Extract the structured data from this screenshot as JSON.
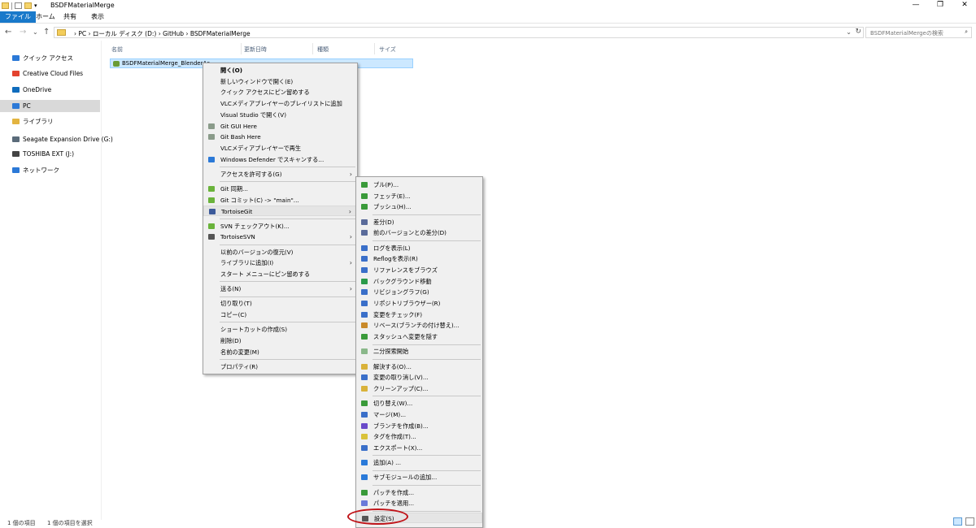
{
  "window": {
    "title": "BSDFMaterialMerge",
    "min": "—",
    "max": "❐",
    "close": "✕"
  },
  "ribbon": {
    "tabs": [
      "ファイル",
      "ホーム",
      "共有",
      "表示"
    ],
    "active_color": "#1979ca"
  },
  "nav": {
    "back": "←",
    "forward": "→",
    "down": "⌄",
    "up": "↑",
    "breadcrumb": "›  PC  ›  ローカル ディスク (D:)  ›  GitHub  ›  BSDFMaterialMerge",
    "refresh": "↻",
    "search_placeholder": "BSDFMaterialMergeの検索",
    "search_icon": "search-icon"
  },
  "sidebar": {
    "items": [
      {
        "label": "クイック アクセス",
        "icon": "star-icon",
        "color": "#2b79d7"
      },
      {
        "label": "Creative Cloud Files",
        "icon": "creative-cloud-icon",
        "color": "#e3432f"
      },
      {
        "label": "OneDrive",
        "icon": "cloud-icon",
        "color": "#0f6cbd"
      },
      {
        "label": "PC",
        "icon": "pc-icon",
        "color": "#2b79d7"
      },
      {
        "label": "ライブラリ",
        "icon": "library-icon",
        "color": "#e3b440"
      },
      {
        "label": "Seagate Expansion Drive (G:)",
        "icon": "drive-icon",
        "color": "#5a6b7a"
      },
      {
        "label": "TOSHIBA EXT (J:)",
        "icon": "drive-icon",
        "color": "#444444"
      },
      {
        "label": "ネットワーク",
        "icon": "network-icon",
        "color": "#2b79d7"
      }
    ],
    "selected_index": 3
  },
  "columns": [
    "名前",
    "更新日時",
    "種類",
    "サイズ"
  ],
  "file": {
    "name": "BSDFMaterialMerge_BlenderAc",
    "icon": "blender-file-icon"
  },
  "context_menu": {
    "items": [
      {
        "label": "開く(O)",
        "bold": true
      },
      {
        "label": "新しいウィンドウで開く(E)"
      },
      {
        "label": "クイック アクセスにピン留めする"
      },
      {
        "label": "VLCメディアプレイヤーのプレイリストに追加"
      },
      {
        "label": "Visual Studio で開く(V)"
      },
      {
        "label": "Git GUI Here",
        "icon": "git-icon",
        "color": "#8a9b8a"
      },
      {
        "label": "Git Bash Here",
        "icon": "git-icon",
        "color": "#8a9b8a"
      },
      {
        "label": "VLCメディアプレイヤーで再生"
      },
      {
        "label": "Windows Defender でスキャンする...",
        "icon": "defender-icon",
        "color": "#2b79d7"
      },
      {
        "sep": true
      },
      {
        "label": "アクセスを許可する(G)",
        "arrow": true
      },
      {
        "sep": true
      },
      {
        "label": "Git 同期...",
        "icon": "git-sync-icon",
        "color": "#6ab33b"
      },
      {
        "label": "Git コミット(C) -> \"main\"...",
        "icon": "git-commit-icon",
        "color": "#6ab33b"
      },
      {
        "label": "TortoiseGit",
        "icon": "tortoisegit-icon",
        "color": "#3c5a9a",
        "arrow": true,
        "highlight": true
      },
      {
        "sep": true
      },
      {
        "label": "SVN チェックアウト(K)...",
        "icon": "svn-checkout-icon",
        "color": "#6ab33b"
      },
      {
        "label": "TortoiseSVN",
        "icon": "tortoisesvn-icon",
        "color": "#555555",
        "arrow": true
      },
      {
        "sep": true
      },
      {
        "label": "以前のバージョンの復元(V)"
      },
      {
        "label": "ライブラリに追加(I)",
        "arrow": true
      },
      {
        "label": "スタート メニューにピン留めする"
      },
      {
        "sep": true
      },
      {
        "label": "送る(N)",
        "arrow": true
      },
      {
        "sep": true
      },
      {
        "label": "切り取り(T)"
      },
      {
        "label": "コピー(C)"
      },
      {
        "sep": true
      },
      {
        "label": "ショートカットの作成(S)"
      },
      {
        "label": "削除(D)"
      },
      {
        "label": "名前の変更(M)"
      },
      {
        "sep": true
      },
      {
        "label": "プロパティ(R)"
      }
    ]
  },
  "submenu": {
    "items": [
      {
        "label": "プル(P)...",
        "icon": "pull-icon",
        "color": "#3a9a3a"
      },
      {
        "label": "フェッチ(E)...",
        "icon": "fetch-icon",
        "color": "#3a9a3a"
      },
      {
        "label": "プッシュ(H)...",
        "icon": "push-icon",
        "color": "#3a9a3a"
      },
      {
        "sep": true
      },
      {
        "label": "差分(D)",
        "icon": "diff-icon",
        "color": "#5a6b9a"
      },
      {
        "label": "前のバージョンとの差分(D)",
        "icon": "diff-icon",
        "color": "#5a6b9a"
      },
      {
        "sep": true
      },
      {
        "label": "ログを表示(L)",
        "icon": "log-icon",
        "color": "#3a6fc9"
      },
      {
        "label": "Reflogを表示(R)",
        "icon": "reflog-icon",
        "color": "#3a6fc9"
      },
      {
        "label": "リファレンスをブラウズ",
        "icon": "browse-refs-icon",
        "color": "#3a6fc9"
      },
      {
        "label": "バックグラウンド移動",
        "icon": "background-icon",
        "color": "#2a9a4a"
      },
      {
        "label": "リビジョングラフ(G)",
        "icon": "revision-graph-icon",
        "color": "#3a6fc9"
      },
      {
        "label": "リポジトリブラウザー(R)",
        "icon": "repo-browser-icon",
        "color": "#3a6fc9"
      },
      {
        "label": "変更をチェック(F)",
        "icon": "check-changes-icon",
        "color": "#3a6fc9"
      },
      {
        "label": "リベース(ブランチの付け替え)...",
        "icon": "rebase-icon",
        "color": "#c98a2a"
      },
      {
        "label": "スタッシュへ変更を隠す",
        "icon": "stash-icon",
        "color": "#3a9a3a"
      },
      {
        "sep": true
      },
      {
        "label": "二分探索開始",
        "icon": "bisect-icon",
        "color": "#8ab88a"
      },
      {
        "sep": true
      },
      {
        "label": "解決する(O)...",
        "icon": "resolve-icon",
        "color": "#d9b23a"
      },
      {
        "label": "変更の取り消し(V)...",
        "icon": "revert-icon",
        "color": "#3a6fc9"
      },
      {
        "label": "クリーンアップ(C)...",
        "icon": "cleanup-icon",
        "color": "#d9b23a"
      },
      {
        "sep": true
      },
      {
        "label": "切り替え(W)...",
        "icon": "switch-icon",
        "color": "#3a9a3a"
      },
      {
        "label": "マージ(M)...",
        "icon": "merge-icon",
        "color": "#3a6fc9"
      },
      {
        "label": "ブランチを作成(B)...",
        "icon": "branch-icon",
        "color": "#6a4ac9"
      },
      {
        "label": "タグを作成(T)...",
        "icon": "tag-icon",
        "color": "#d9c23a"
      },
      {
        "label": "エクスポート(X)...",
        "icon": "export-icon",
        "color": "#3a6fc9"
      },
      {
        "sep": true
      },
      {
        "label": "追加(A) ...",
        "icon": "add-icon",
        "color": "#2a7ad9"
      },
      {
        "sep": true
      },
      {
        "label": "サブモジュールの追加...",
        "icon": "submodule-icon",
        "color": "#2a7ad9"
      },
      {
        "sep": true
      },
      {
        "label": "パッチを作成...",
        "icon": "create-patch-icon",
        "color": "#3a9a3a"
      },
      {
        "label": "パッチを適用...",
        "icon": "apply-patch-icon",
        "color": "#6a7ad9"
      },
      {
        "sep": true
      },
      {
        "label": "設定(S)",
        "icon": "settings-icon",
        "color": "#555555",
        "highlight": true
      }
    ]
  },
  "status": {
    "count": "1 個の項目",
    "selected": "1 個の項目を選択"
  },
  "annotation_color": "#c0151a"
}
